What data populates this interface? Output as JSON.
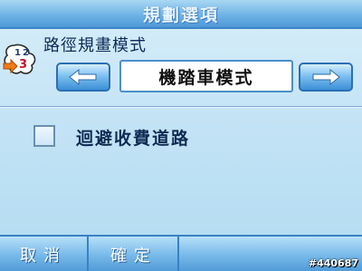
{
  "header": {
    "title": "規劃選項"
  },
  "route_mode": {
    "label": "路徑規畫模式",
    "value": "機踏車模式",
    "icon": "route-123-icon",
    "icon_digits": [
      "1",
      "2",
      "3"
    ]
  },
  "options": {
    "avoid_toll_label": "迴避收費道路",
    "avoid_toll_checked": false
  },
  "footer": {
    "cancel_label": "取消",
    "ok_label": "確定"
  },
  "watermark": "#440687",
  "colors": {
    "accent": "#4f98d8",
    "background": "#c3e3f5",
    "text": "#0d2b57"
  }
}
